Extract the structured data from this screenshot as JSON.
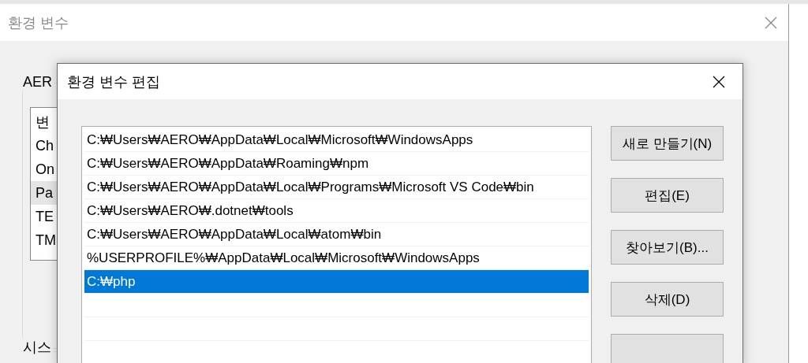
{
  "outer_window": {
    "title": "환경 변수",
    "user_group": {
      "label": "AER",
      "header": "변",
      "rows": [
        {
          "text": "Ch",
          "selected": false
        },
        {
          "text": "On",
          "selected": false
        },
        {
          "text": "Pa",
          "selected": true
        },
        {
          "text": "TE",
          "selected": false
        },
        {
          "text": "TM",
          "selected": false
        }
      ]
    },
    "system_group": {
      "label": "시스"
    }
  },
  "dialog": {
    "title": "환경 변수 편집",
    "paths": [
      {
        "text": "C:₩Users₩AERO₩AppData₩Local₩Microsoft₩WindowsApps",
        "selected": false
      },
      {
        "text": "C:₩Users₩AERO₩AppData₩Roaming₩npm",
        "selected": false
      },
      {
        "text": "C:₩Users₩AERO₩AppData₩Local₩Programs₩Microsoft VS Code₩bin",
        "selected": false
      },
      {
        "text": "C:₩Users₩AERO₩.dotnet₩tools",
        "selected": false
      },
      {
        "text": "C:₩Users₩AERO₩AppData₩Local₩atom₩bin",
        "selected": false
      },
      {
        "text": "%USERPROFILE%₩AppData₩Local₩Microsoft₩WindowsApps",
        "selected": false
      },
      {
        "text": "C:₩php",
        "selected": true
      }
    ],
    "buttons": [
      "새로 만들기(N)",
      "편집(E)",
      "찾아보기(B)...",
      "삭제(D)"
    ]
  }
}
